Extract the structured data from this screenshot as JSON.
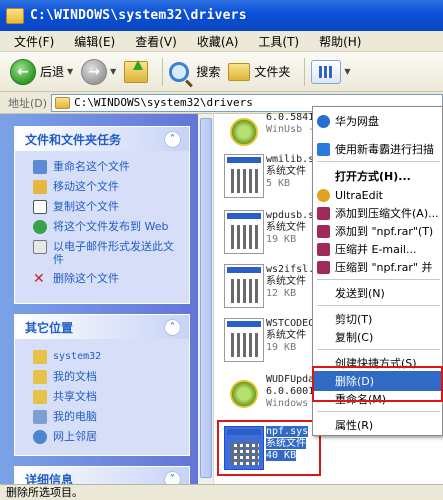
{
  "window": {
    "title": "C:\\WINDOWS\\system32\\drivers"
  },
  "menu": [
    "文件(F)",
    "编辑(E)",
    "查看(V)",
    "收藏(A)",
    "工具(T)",
    "帮助(H)"
  ],
  "toolbar": {
    "back": "后退",
    "search": "搜索",
    "folders": "文件夹"
  },
  "address": {
    "label": "地址(D)",
    "value": "C:\\WINDOWS\\system32\\drivers"
  },
  "tasks": {
    "title": "文件和文件夹任务",
    "items": [
      "重命名这个文件",
      "移动这个文件",
      "复制这个文件",
      "将这个文件发布到 Web",
      "以电子邮件形式发送此文件",
      "删除这个文件"
    ]
  },
  "places": {
    "title": "其它位置",
    "items": [
      "system32",
      "我的文档",
      "共享文档",
      "我的电脑",
      "网上邻居"
    ]
  },
  "details_title": "详细信息",
  "files": [
    {
      "name": "6.0.5841",
      "type": "WinUsb -",
      "size": ""
    },
    {
      "name": "wmilib.sys",
      "type": "系统文件",
      "size": "5 KB"
    },
    {
      "name": "wpdusb.sys",
      "type": "系统文件",
      "size": "19 KB"
    },
    {
      "name": "ws2ifsl.sys",
      "type": "系统文件",
      "size": "12 KB"
    },
    {
      "name": "WSTCODEC",
      "type": "系统文件",
      "size": "19 KB"
    },
    {
      "name": "WUDFUpda",
      "type": "6.0.6001",
      "size": "Windows"
    },
    {
      "name": "npf.sys",
      "type": "系统文件",
      "size": "40 KB"
    }
  ],
  "context_menu": {
    "items": [
      "华为网盘",
      "使用新毒霸进行扫描",
      "打开方式(H)...",
      "UltraEdit",
      "添加到压缩文件(A)...",
      "添加到 \"npf.rar\"(T)",
      "压缩并 E-mail...",
      "压缩到 \"npf.rar\" 并",
      "发送到(N)",
      "剪切(T)",
      "复制(C)",
      "创建快捷方式(S)",
      "删除(D)",
      "重命名(M)",
      "属性(R)"
    ]
  },
  "status": "删除所选项目。",
  "colors": {
    "accent": "#316ac5",
    "titlebar": "#0a4fd6",
    "highlight_box": "#d81818"
  }
}
